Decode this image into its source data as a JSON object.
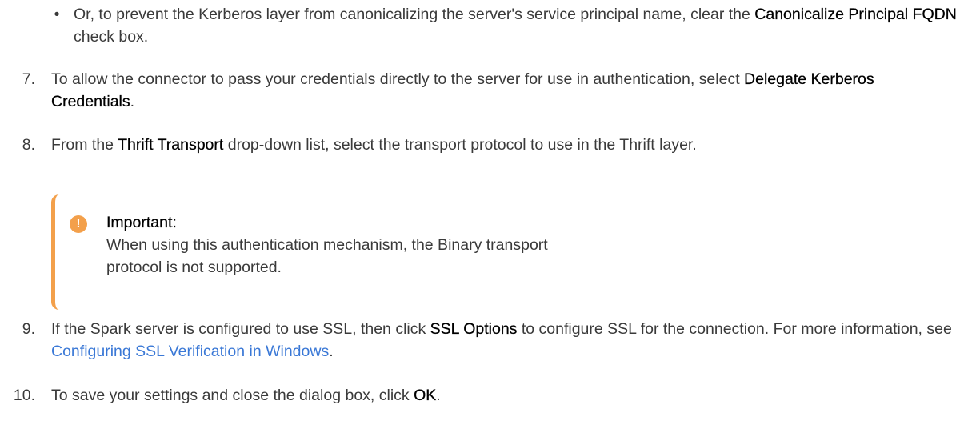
{
  "bullet": {
    "symbol": "•",
    "text_before": "Or, to prevent the Kerberos layer from canonicalizing the server's service principal name, clear the ",
    "bold": "Canonicalize Principal FQDN",
    "text_after": " check box."
  },
  "steps": [
    {
      "number": "7.",
      "text_before": "To allow the connector to pass your credentials directly to the server for use in authentication, select ",
      "bold": "Delegate Kerberos Credentials",
      "text_after": "."
    },
    {
      "number": "8.",
      "text_before": "From the ",
      "bold": "Thrift Transport",
      "text_after": " drop-down list, select the transport protocol to use in the Thrift layer."
    },
    {
      "number": "9.",
      "text_before": "If the Spark server is configured to use SSL, then click ",
      "bold": "SSL Options",
      "text_middle": " to configure SSL for the connection. For more information, see ",
      "link": "Configuring SSL Verification in Windows",
      "text_after": "."
    },
    {
      "number": "10.",
      "text_before": "To save your settings and close the dialog box, click ",
      "bold": "OK",
      "text_after": "."
    }
  ],
  "note": {
    "icon": "warning-icon",
    "icon_glyph": "!",
    "title": "Important:",
    "body": "When using this authentication mechanism, the Binary transport protocol is not supported.",
    "accent_color": "#f3a04b"
  },
  "colors": {
    "text": "#3a3a3a",
    "bold_text": "#000000",
    "link": "#3a78d6"
  }
}
